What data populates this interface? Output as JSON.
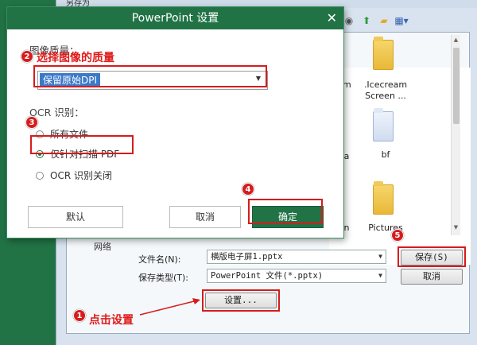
{
  "background": {
    "window_title": "另存为",
    "file_labels": [
      ".Icecream Screen ...",
      "bf",
      "Pictures"
    ],
    "partial_labels": [
      "m",
      "a",
      "n"
    ],
    "nav_item": "网络",
    "filename_label": "文件名(N):",
    "filename_value": "横版电子屏1.pptx",
    "type_label": "保存类型(T):",
    "type_value": "PowerPoint 文件(*.pptx)",
    "save_button": "保存(S)",
    "cancel_button": "取消",
    "settings_button": "设置..."
  },
  "dialog": {
    "title": "PowerPoint 设置",
    "image_quality_label": "图像质量：",
    "image_quality_value": "保留原始DPI",
    "ocr_label": "OCR 识别：",
    "ocr_options": [
      {
        "label": "所有文件",
        "selected": false
      },
      {
        "label": "仅针对扫描 PDF",
        "selected": true
      },
      {
        "label": "OCR 识别关闭",
        "selected": false
      }
    ],
    "default_button": "默认",
    "cancel_button": "取消",
    "ok_button": "确定"
  },
  "annotations": {
    "step1": "点击设置",
    "step2": "选择图像的质量",
    "badges": [
      "1",
      "2",
      "3",
      "4",
      "5"
    ],
    "color": "#d61c1c"
  }
}
